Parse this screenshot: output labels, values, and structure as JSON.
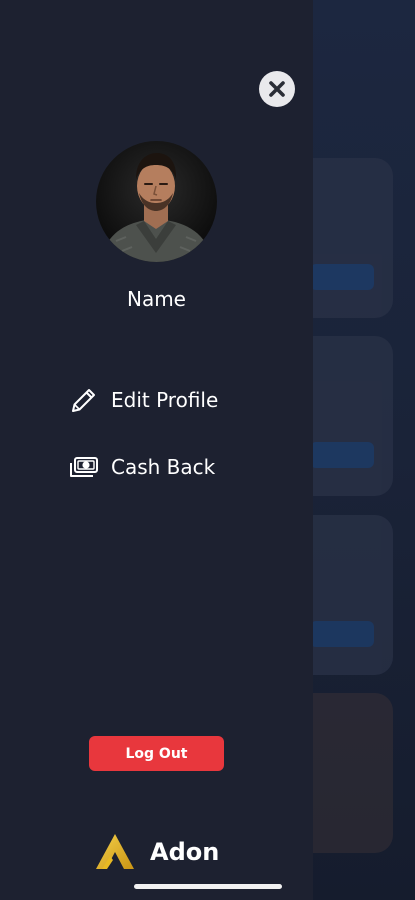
{
  "drawer": {
    "profile": {
      "name": "Name"
    },
    "menu": [
      {
        "label": "Edit Profile",
        "icon": "pencil-icon"
      },
      {
        "label": "Cash Back",
        "icon": "cash-icon"
      }
    ],
    "logout_label": "Log Out",
    "brand_name": "Adon"
  },
  "colors": {
    "drawer_bg": "#1d2130",
    "logout_bg": "#e8373d",
    "brand_gold": "#e8b923",
    "close_bg": "#e9e9ec"
  }
}
